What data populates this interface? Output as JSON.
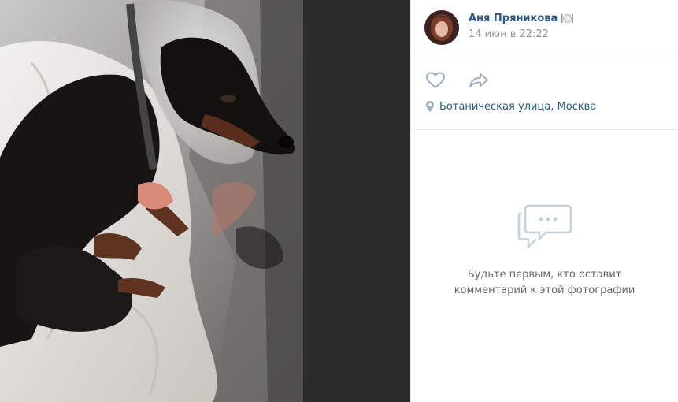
{
  "author": {
    "name": "Аня Пряникова",
    "name_emoji_icon": "plate-cutlery-icon",
    "date": "14 июн в 22:22"
  },
  "actions": {
    "like_icon": "heart-icon",
    "share_icon": "share-arrow-icon"
  },
  "location": {
    "icon": "location-pin-icon",
    "text": "Ботаническая улица, Москва"
  },
  "comments": {
    "empty_icon": "comments-bubble-icon",
    "empty_line1": "Будьте первым, кто оставит",
    "empty_line2": "комментарий к этой фотографии"
  },
  "colors": {
    "link": "#2a5885",
    "muted": "#939393",
    "icon": "#9db0c4",
    "backdrop": "#2b2b2b"
  }
}
